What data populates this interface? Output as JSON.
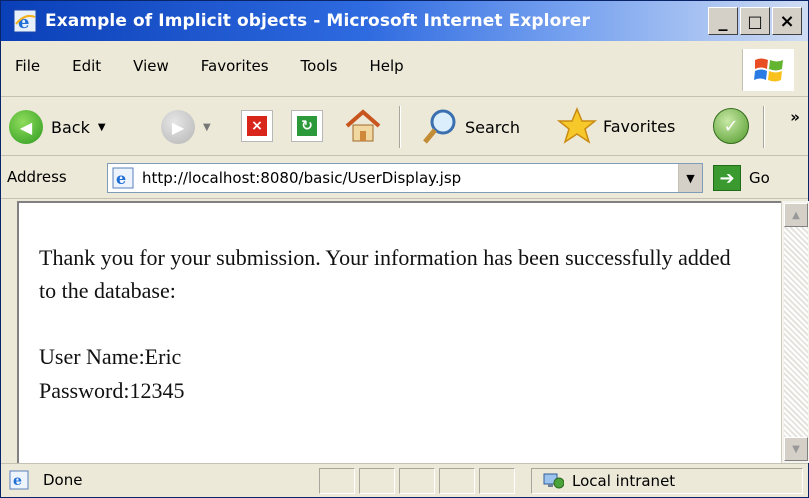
{
  "window": {
    "title": "Example of Implicit objects - Microsoft Internet Explorer",
    "controls": {
      "minimize": "_",
      "maximize": "□",
      "close": "×"
    }
  },
  "menubar": {
    "items": [
      "File",
      "Edit",
      "View",
      "Favorites",
      "Tools",
      "Help"
    ]
  },
  "toolbar": {
    "back_label": "Back",
    "search_label": "Search",
    "favorites_label": "Favorites",
    "more": "»"
  },
  "addressbar": {
    "label": "Address",
    "url": "http://localhost:8080/basic/UserDisplay.jsp",
    "go_label": "Go"
  },
  "content": {
    "message": "Thank you for your submission. Your information has been successfully added to the database:",
    "user_name_line": "User Name:Eric",
    "password_line": "Password:12345"
  },
  "statusbar": {
    "status": "Done",
    "zone": "Local intranet"
  },
  "colors": {
    "title_start": "#0a3fb8",
    "title_end": "#cfdcf3",
    "chrome": "#ece9d8",
    "go_green": "#3a9a2f"
  }
}
